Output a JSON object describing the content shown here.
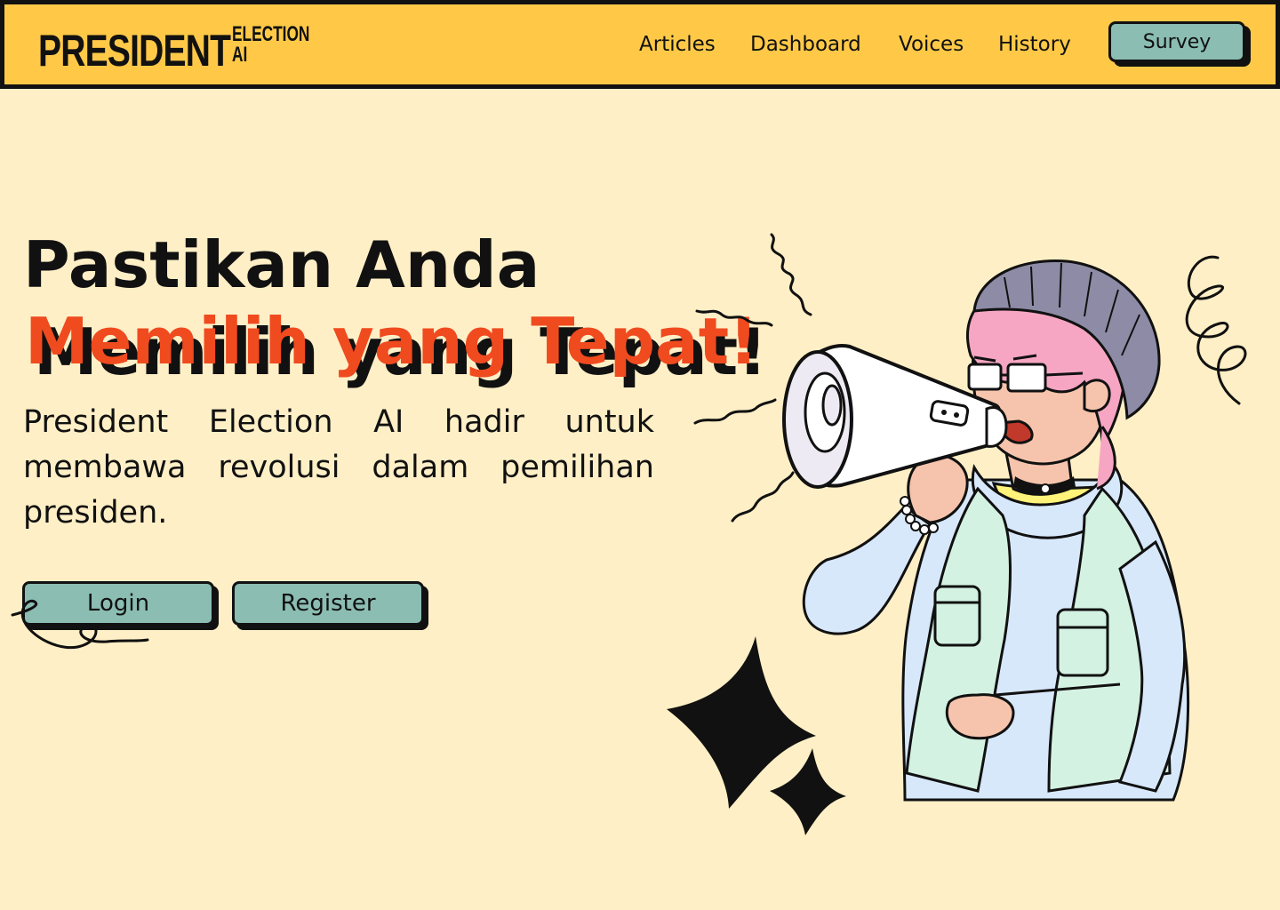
{
  "header": {
    "logo": {
      "main": "PRESIDENT",
      "sub_line1": "ELECTION",
      "sub_line2": "AI"
    },
    "nav": [
      {
        "label": "Articles"
      },
      {
        "label": "Dashboard"
      },
      {
        "label": "Voices"
      },
      {
        "label": "History"
      }
    ],
    "survey_label": "Survey"
  },
  "hero": {
    "title_line1": "Pastikan Anda",
    "title_line2": "Memilih yang Tepat!",
    "description": "President Election AI hadir untuk membawa revolusi dalam pemilihan presiden.",
    "login_label": "Login",
    "register_label": "Register"
  },
  "colors": {
    "background": "#FFEFC6",
    "navbar": "#FFC947",
    "button": "#8BBDB2",
    "accent": "#F04A1F",
    "ink": "#111111"
  },
  "icons": {
    "illustration": "person-shouting-megaphone-illustration",
    "sparkles": "four-point-sparkle-icon",
    "swirl": "loop-swirl-doodle"
  }
}
